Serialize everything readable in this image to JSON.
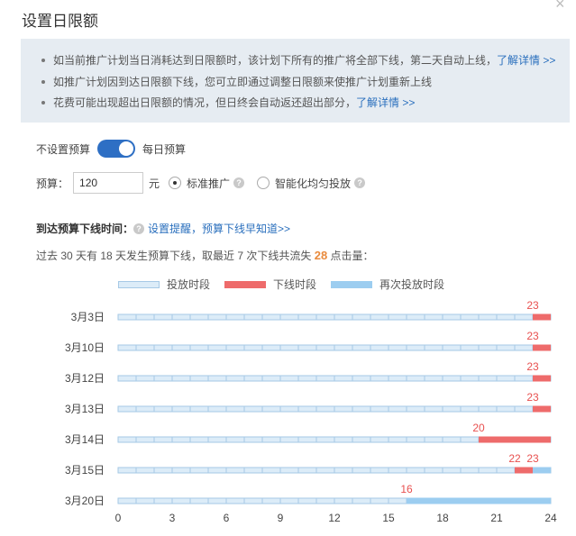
{
  "dialog": {
    "title": "设置日限额",
    "close_icon": "close-icon"
  },
  "notice": {
    "items": [
      {
        "text": "如当前推广计划当日消耗达到日限额时，该计划下所有的推广将全部下线，第二天自动上线，",
        "link": "了解详情 >>"
      },
      {
        "text": "如推广计划因到达日限额下线，您可立即通过调整日限额来使推广计划重新上线",
        "link": ""
      },
      {
        "text": "花费可能出现超出日限额的情况，但日终会自动返还超出部分，",
        "link": "了解详情 >>"
      }
    ]
  },
  "budget_toggle": {
    "off_label": "不设置预算",
    "on_label": "每日预算",
    "state": "on"
  },
  "budget": {
    "label": "预算：",
    "value": "120",
    "unit": "元",
    "options": [
      {
        "label": "标准推广",
        "checked": true
      },
      {
        "label": "智能化均匀投放",
        "checked": false
      }
    ]
  },
  "offline_section": {
    "title": "到达预算下线时间：",
    "link": "设置提醒，预算下线早知道>>"
  },
  "summary": {
    "prefix": "过去 30 天有 18 天发生预算下线，取最近 7 次下线共流失 ",
    "lost_clicks": "28",
    "suffix": " 点击量："
  },
  "legend": {
    "items": [
      {
        "label": "投放时段",
        "color": "#dcecf8"
      },
      {
        "label": "下线时段",
        "color": "#ee6b6b"
      },
      {
        "label": "再次投放时段",
        "color": "#9ccdf0"
      }
    ]
  },
  "colors": {
    "active": "#dcecf8",
    "active_border": "#a6c9e6",
    "offline": "#ee6b6b",
    "resumed": "#9ccdf0",
    "offline_label": "#e8504f"
  },
  "chart_data": {
    "type": "bar",
    "orientation": "horizontal-timeline",
    "xlim": [
      0,
      24
    ],
    "xticks": [
      0,
      3,
      6,
      9,
      12,
      15,
      18,
      21,
      24
    ],
    "rows": [
      {
        "date": "3月3日",
        "offline_start": 23,
        "offline_end": 24,
        "resume": null,
        "labels": [
          "23"
        ]
      },
      {
        "date": "3月10日",
        "offline_start": 23,
        "offline_end": 24,
        "resume": null,
        "labels": [
          "23"
        ]
      },
      {
        "date": "3月12日",
        "offline_start": 23,
        "offline_end": 24,
        "resume": null,
        "labels": [
          "23"
        ]
      },
      {
        "date": "3月13日",
        "offline_start": 23,
        "offline_end": 24,
        "resume": null,
        "labels": [
          "23"
        ]
      },
      {
        "date": "3月14日",
        "offline_start": 20,
        "offline_end": 24,
        "resume": null,
        "labels": [
          "20"
        ]
      },
      {
        "date": "3月15日",
        "offline_start": 22,
        "offline_end": 23,
        "resume": 23,
        "labels": [
          "22",
          "23"
        ]
      },
      {
        "date": "3月20日",
        "offline_start": 16,
        "offline_end": 16,
        "resume": 16,
        "labels": [
          "16"
        ]
      }
    ]
  }
}
